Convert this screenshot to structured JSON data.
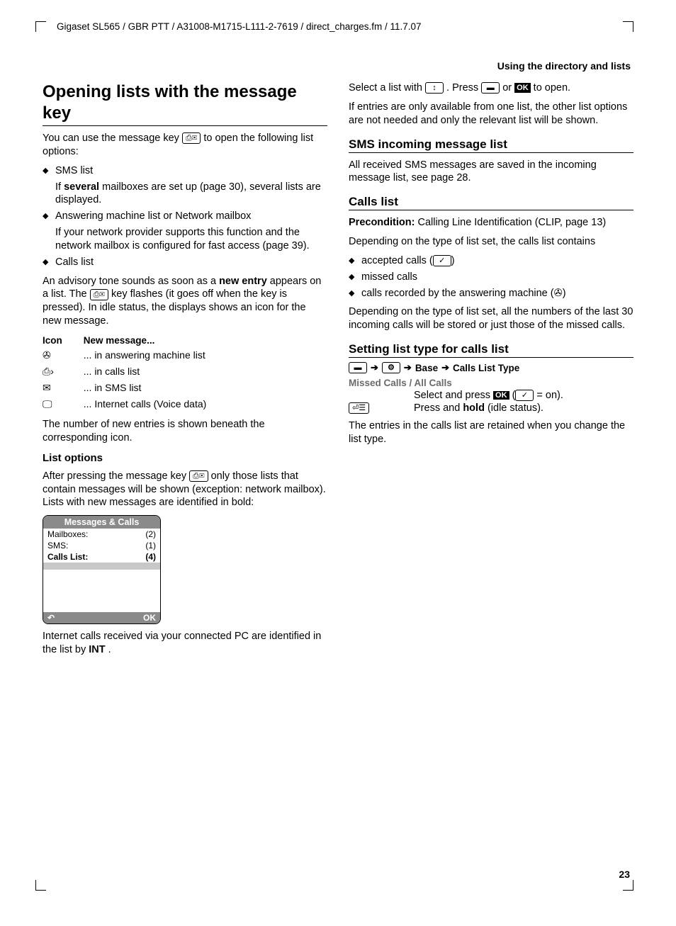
{
  "header": "Gigaset SL565 / GBR PTT / A31008-M1715-L111-2-7619 / direct_charges.fm / 11.7.07",
  "section_header": "Using the directory and lists",
  "page_number": "23",
  "left": {
    "h1": "Opening lists with the message key",
    "intro_a": "You can use the message key ",
    "intro_b": " to open the following list options:",
    "bullets": {
      "b1": "SMS list",
      "b1_sub_a": "If ",
      "b1_sub_bold": "several",
      "b1_sub_b": " mailboxes are set up (page 30), several lists are displayed.",
      "b2": "Answering machine list or Network mailbox",
      "b2_sub": "If your network provider supports this function and the network mailbox is configured for fast access (page 39).",
      "b3": "Calls list"
    },
    "advisory_a": "An advisory tone sounds as soon as a ",
    "advisory_bold1": "new entry",
    "advisory_b": " appears on a list. The ",
    "advisory_c": " key flashes (it goes off when the key is pressed). In idle status, the displays shows an icon for the new message.",
    "table": {
      "h_icon": "Icon",
      "h_msg": "New message...",
      "r1": "... in answering machine list",
      "r2": "... in calls list",
      "r3": "... in SMS list",
      "r4": "... Internet calls (Voice data)"
    },
    "below_table": "The number of new entries is shown beneath the corresponding icon.",
    "h3_list_options": "List options",
    "list_options_a": "After pressing the message key ",
    "list_options_b": " only those lists that contain messages will be shown (exception: network mailbox). Lists with new messages are identified in bold:",
    "phone": {
      "title": "Messages & Calls",
      "row1_label": "Mailboxes:",
      "row1_val": "(2)",
      "row2_label": "SMS:",
      "row2_val": "(1)",
      "row3_label": "Calls List:",
      "row3_val": "(4)",
      "back_icon": "↶",
      "ok": "OK"
    },
    "internet_calls_a": "Internet calls received via your connected PC are identified in the list by ",
    "internet_calls_bold": "INT",
    "internet_calls_b": " ."
  },
  "right": {
    "select_a": "Select a list with ",
    "select_b": ". Press ",
    "select_c": " or ",
    "select_d": " to open.",
    "ok_label": "OK",
    "one_list": "If entries are only available from one list, the other list options are not needed and only the relevant list will be shown.",
    "h2_sms": "SMS incoming message list",
    "sms_body": "All received SMS messages are saved in the incoming message list, see page 28.",
    "h2_calls": "Calls list",
    "precondition_label": "Precondition:",
    "precondition_text": " Calling Line Identification (CLIP, page 13)",
    "depending": "Depending on the type of list set, the calls list contains",
    "cb1_a": "accepted calls (",
    "cb1_b": ")",
    "cb2": "missed calls",
    "cb3_a": "calls recorded by the answering machine (",
    "cb3_b": ")",
    "last30": "Depending on the type of list set, all the numbers of the last 30 incoming calls will be stored or just those of the missed calls.",
    "h2_setting": "Setting list type for calls list",
    "nav": {
      "base": "Base",
      "type": "Calls List Type"
    },
    "missed_all": "Missed Calls / All Calls",
    "step1_a": "Select and press ",
    "step1_b": " (",
    "step1_c": " = on).",
    "step2_a": "Press and ",
    "step2_bold": "hold",
    "step2_b": " (idle status).",
    "retained": "The entries in the calls list are retained when you change the list type."
  }
}
